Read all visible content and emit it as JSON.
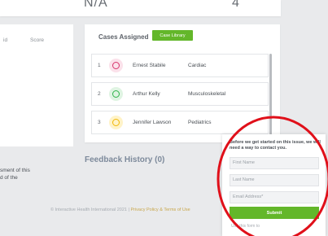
{
  "stats": {
    "value_a": "N/A",
    "value_b": "4"
  },
  "left_table": {
    "col_id": "id",
    "col_score": "Score"
  },
  "cases": {
    "title": "Cases Assigned",
    "library_button": "Case Library",
    "rows": [
      {
        "num": "1",
        "name": "Ernest Stabile",
        "specialty": "Cardiac",
        "icon": "heart-icon",
        "color": "#d6336c"
      },
      {
        "num": "2",
        "name": "Arthur Kelly",
        "specialty": "Musculoskeletal",
        "icon": "muscle-icon",
        "color": "#2fb34a"
      },
      {
        "num": "3",
        "name": "Jennifer Lawson",
        "specialty": "Pediatrics",
        "icon": "baby-icon",
        "color": "#f2b705"
      }
    ]
  },
  "left_text": {
    "line1": "sment of this",
    "line2": "d of the"
  },
  "feedback": {
    "title": "Feedback History (0)"
  },
  "footer": {
    "copyright": "© Interactive Health International 2021 |",
    "privacy": "Privacy Policy",
    "amp": "&",
    "terms": "Terms of Use"
  },
  "contact_popup": {
    "message": "Before we get started on this issue, we will need a way to contact you.",
    "first_name_placeholder": "First Name",
    "last_name_placeholder": "Last Name",
    "email_placeholder": "Email Address*",
    "submit_label": "Submit",
    "small_text": "Use this form to"
  },
  "colors": {
    "accent_green": "#63b72a",
    "highlight_red": "#e0101a"
  }
}
